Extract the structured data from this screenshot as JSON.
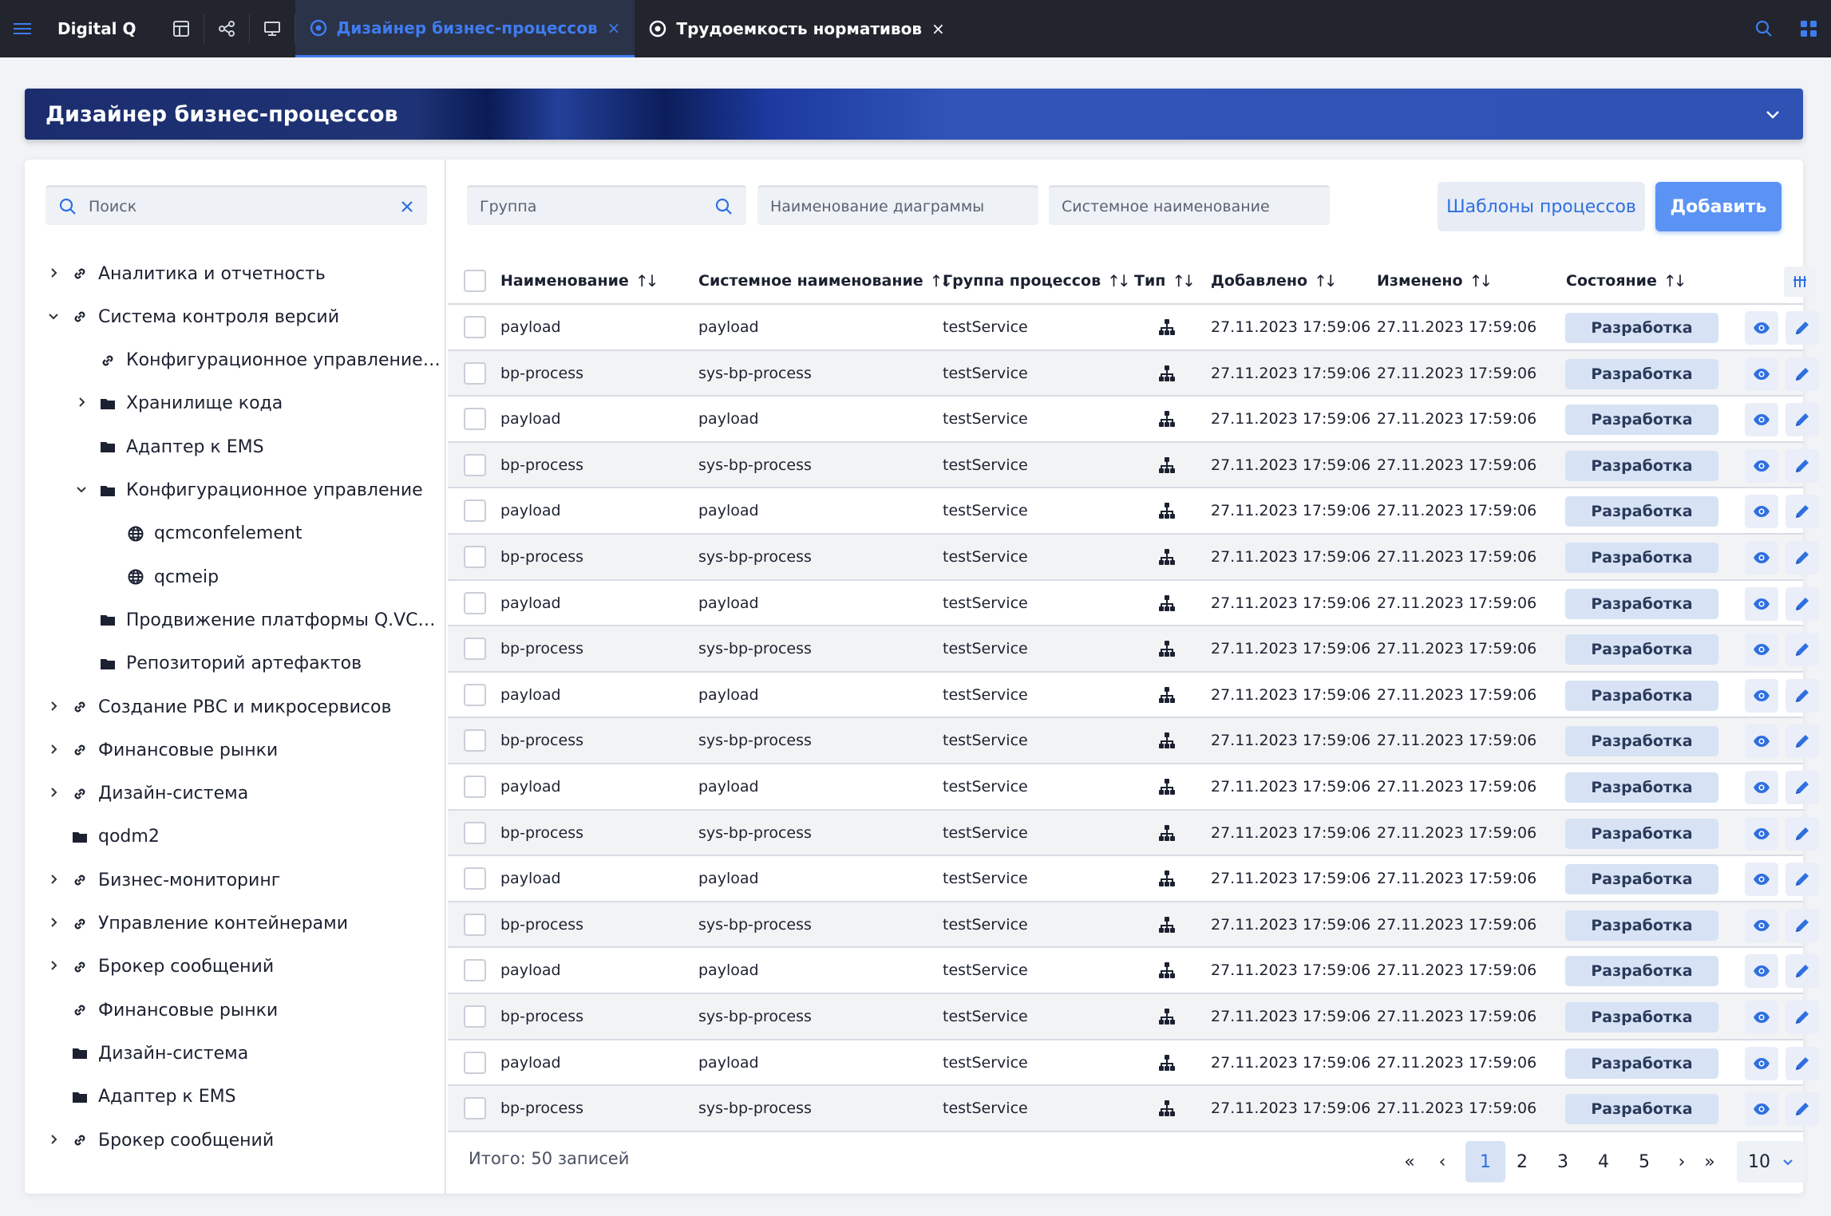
{
  "topbar": {
    "brand": "Digital Q",
    "tabs": [
      {
        "label": "Дизайнер бизнес-процессов",
        "active": true
      },
      {
        "label": "Трудоемкость нормативов",
        "active": false
      }
    ],
    "close_glyph": "×"
  },
  "banner": {
    "title": "Дизайнер бизнес-процессов"
  },
  "sidebar": {
    "search_placeholder": "Поиск",
    "tree": [
      {
        "label": "Аналитика и отчетность",
        "icon": "link-icon",
        "level": 0,
        "chevron": "right"
      },
      {
        "label": "Система контроля версий",
        "icon": "link-icon",
        "level": 0,
        "chevron": "down"
      },
      {
        "label": "Конфигурационное управление…",
        "icon": "link-icon",
        "level": 1,
        "chevron": "none"
      },
      {
        "label": "Хранилище кода",
        "icon": "folder-icon",
        "level": 1,
        "chevron": "right"
      },
      {
        "label": "Адаптер к EMS",
        "icon": "folder-icon",
        "level": 1,
        "chevron": "none"
      },
      {
        "label": "Конфигурационное управление",
        "icon": "folder-icon",
        "level": 1,
        "chevron": "down"
      },
      {
        "label": "qcmconfelement",
        "icon": "globe-icon",
        "level": 2,
        "chevron": "none"
      },
      {
        "label": "qcmeip",
        "icon": "globe-icon",
        "level": 2,
        "chevron": "none"
      },
      {
        "label": "Продвижение платформы Q.VCS…",
        "icon": "folder-icon",
        "level": 1,
        "chevron": "none"
      },
      {
        "label": "Репозиторий артефактов",
        "icon": "folder-icon",
        "level": 1,
        "chevron": "none"
      },
      {
        "label": "Создание РВС и микросервисов",
        "icon": "link-icon",
        "level": 0,
        "chevron": "right"
      },
      {
        "label": "Финансовые рынки",
        "icon": "link-icon",
        "level": 0,
        "chevron": "right"
      },
      {
        "label": "Дизайн-система",
        "icon": "link-icon",
        "level": 0,
        "chevron": "right"
      },
      {
        "label": "qodm2",
        "icon": "folder-icon",
        "level": 0,
        "chevron": "none"
      },
      {
        "label": "Бизнес-мониторинг",
        "icon": "link-icon",
        "level": 0,
        "chevron": "right"
      },
      {
        "label": "Управление контейнерами",
        "icon": "link-icon",
        "level": 0,
        "chevron": "right"
      },
      {
        "label": "Брокер сообщений",
        "icon": "link-icon",
        "level": 0,
        "chevron": "right"
      },
      {
        "label": "Финансовые рынки",
        "icon": "link-icon",
        "level": 0,
        "chevron": "none"
      },
      {
        "label": "Дизайн-система",
        "icon": "folder-icon",
        "level": 0,
        "chevron": "none"
      },
      {
        "label": "Адаптер к EMS",
        "icon": "folder-icon",
        "level": 0,
        "chevron": "none"
      },
      {
        "label": "Брокер сообщений",
        "icon": "link-icon",
        "level": 0,
        "chevron": "right"
      }
    ]
  },
  "filters": {
    "group_placeholder": "Группа",
    "diagram_name_placeholder": "Наименование диаграммы",
    "system_name_placeholder": "Системное наименование"
  },
  "buttons": {
    "templates": "Шаблоны процессов",
    "add": "Добавить"
  },
  "table": {
    "columns": [
      "Наименование",
      "Системное наименование",
      "Группа процессов",
      "Тип",
      "Добавлено",
      "Изменено",
      "Состояние"
    ],
    "rows": [
      {
        "name": "payload",
        "sys": "payload",
        "group": "testService",
        "added": "27.11.2023 17:59:06",
        "changed": "27.11.2023 17:59:06",
        "status": "Разработка"
      },
      {
        "name": "bp-process",
        "sys": "sys-bp-process",
        "group": "testService",
        "added": "27.11.2023 17:59:06",
        "changed": "27.11.2023 17:59:06",
        "status": "Разработка"
      },
      {
        "name": "payload",
        "sys": "payload",
        "group": "testService",
        "added": "27.11.2023 17:59:06",
        "changed": "27.11.2023 17:59:06",
        "status": "Разработка"
      },
      {
        "name": "bp-process",
        "sys": "sys-bp-process",
        "group": "testService",
        "added": "27.11.2023 17:59:06",
        "changed": "27.11.2023 17:59:06",
        "status": "Разработка"
      },
      {
        "name": "payload",
        "sys": "payload",
        "group": "testService",
        "added": "27.11.2023 17:59:06",
        "changed": "27.11.2023 17:59:06",
        "status": "Разработка"
      },
      {
        "name": "bp-process",
        "sys": "sys-bp-process",
        "group": "testService",
        "added": "27.11.2023 17:59:06",
        "changed": "27.11.2023 17:59:06",
        "status": "Разработка"
      },
      {
        "name": "payload",
        "sys": "payload",
        "group": "testService",
        "added": "27.11.2023 17:59:06",
        "changed": "27.11.2023 17:59:06",
        "status": "Разработка"
      },
      {
        "name": "bp-process",
        "sys": "sys-bp-process",
        "group": "testService",
        "added": "27.11.2023 17:59:06",
        "changed": "27.11.2023 17:59:06",
        "status": "Разработка"
      },
      {
        "name": "payload",
        "sys": "payload",
        "group": "testService",
        "added": "27.11.2023 17:59:06",
        "changed": "27.11.2023 17:59:06",
        "status": "Разработка"
      },
      {
        "name": "bp-process",
        "sys": "sys-bp-process",
        "group": "testService",
        "added": "27.11.2023 17:59:06",
        "changed": "27.11.2023 17:59:06",
        "status": "Разработка"
      },
      {
        "name": "payload",
        "sys": "payload",
        "group": "testService",
        "added": "27.11.2023 17:59:06",
        "changed": "27.11.2023 17:59:06",
        "status": "Разработка"
      },
      {
        "name": "bp-process",
        "sys": "sys-bp-process",
        "group": "testService",
        "added": "27.11.2023 17:59:06",
        "changed": "27.11.2023 17:59:06",
        "status": "Разработка"
      },
      {
        "name": "payload",
        "sys": "payload",
        "group": "testService",
        "added": "27.11.2023 17:59:06",
        "changed": "27.11.2023 17:59:06",
        "status": "Разработка"
      },
      {
        "name": "bp-process",
        "sys": "sys-bp-process",
        "group": "testService",
        "added": "27.11.2023 17:59:06",
        "changed": "27.11.2023 17:59:06",
        "status": "Разработка"
      },
      {
        "name": "payload",
        "sys": "payload",
        "group": "testService",
        "added": "27.11.2023 17:59:06",
        "changed": "27.11.2023 17:59:06",
        "status": "Разработка"
      },
      {
        "name": "bp-process",
        "sys": "sys-bp-process",
        "group": "testService",
        "added": "27.11.2023 17:59:06",
        "changed": "27.11.2023 17:59:06",
        "status": "Разработка"
      },
      {
        "name": "payload",
        "sys": "payload",
        "group": "testService",
        "added": "27.11.2023 17:59:06",
        "changed": "27.11.2023 17:59:06",
        "status": "Разработка"
      },
      {
        "name": "bp-process",
        "sys": "sys-bp-process",
        "group": "testService",
        "added": "27.11.2023 17:59:06",
        "changed": "27.11.2023 17:59:06",
        "status": "Разработка"
      }
    ]
  },
  "pagination": {
    "total": "Итого: 50 записей",
    "first": "«",
    "prev": "‹",
    "next": "›",
    "last": "»",
    "pages": [
      "1",
      "2",
      "3",
      "4",
      "5"
    ],
    "current": "1",
    "page_size": "10"
  },
  "colors": {
    "accent": "#3f7cf0",
    "topbar": "#22252e",
    "status_bg": "#d7e2f5"
  }
}
